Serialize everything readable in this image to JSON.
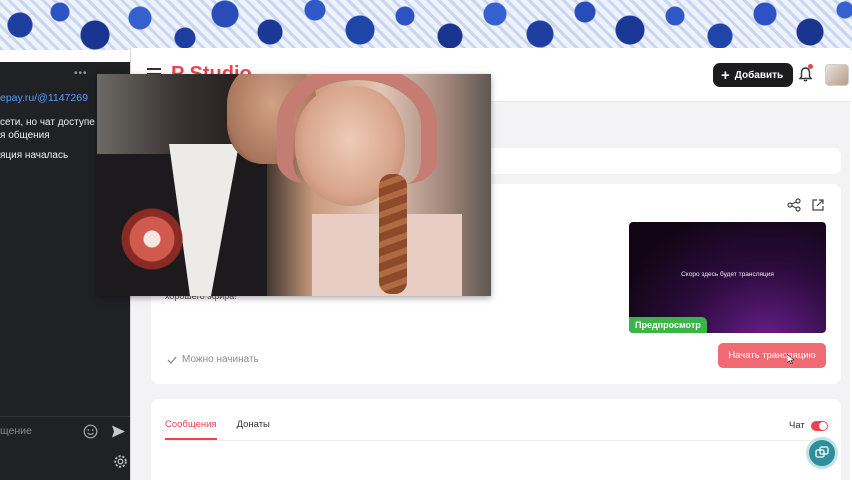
{
  "app": {
    "logo": "P Studio",
    "add_button_label": "Добавить"
  },
  "stream": {
    "preview_text": "Скоро здесь будет трансляция",
    "preview_badge": "Предпросмотр",
    "wish_text": "хорошего эфира!",
    "ready_status": "Можно начинать",
    "start_button_label": "Начать трансляцию"
  },
  "messages_panel": {
    "tabs": [
      {
        "label": "Сообщения",
        "active": true
      },
      {
        "label": "Донаты",
        "active": false
      }
    ],
    "chat_toggle_label": "Чат",
    "chat_enabled": true
  },
  "chat_window": {
    "more_label": "•••",
    "link_text": "epay.ru/@1147269",
    "lines": [
      "сети, но чат доступе",
      "я общения",
      "яция началась"
    ],
    "input_placeholder": "щение"
  },
  "colors": {
    "accent": "#e8464f",
    "start_button": "#ef6a73",
    "preview_badge": "#3cb44a",
    "chat_bg": "#202124",
    "fab": "#2e8f9a"
  },
  "icons": [
    "menu-icon",
    "plus-icon",
    "bell-icon",
    "share-icon",
    "external-link-icon",
    "check-icon",
    "emoji-icon",
    "send-icon",
    "settings-icon",
    "support-chat-icon"
  ]
}
